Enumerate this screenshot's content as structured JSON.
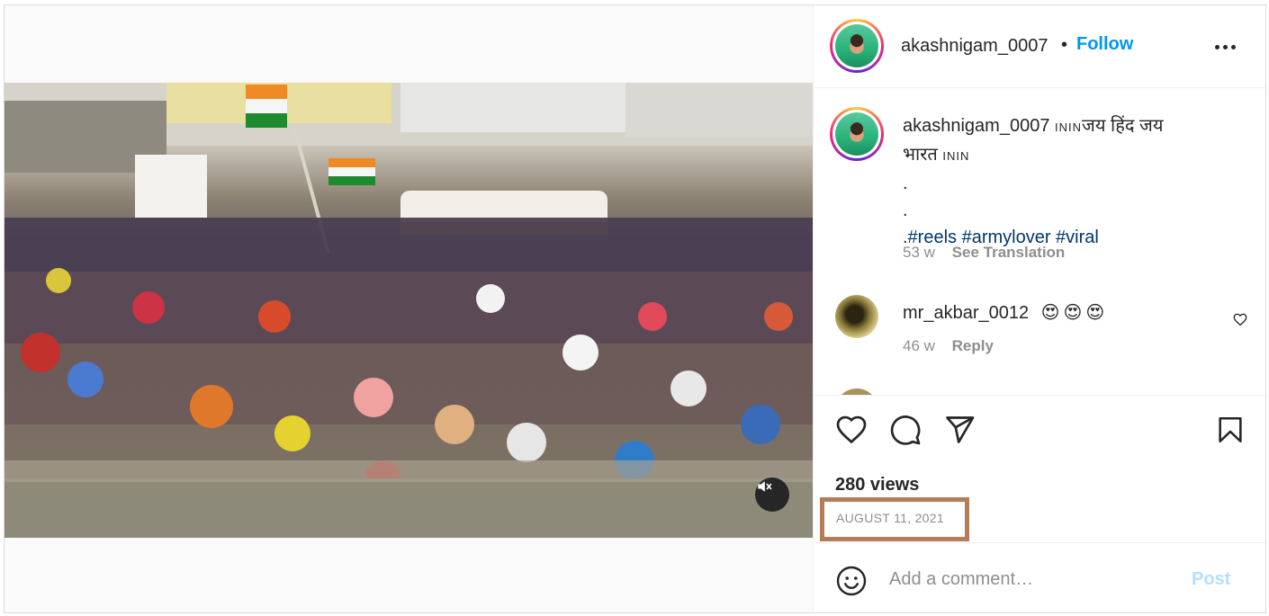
{
  "post": {
    "username": "akashnigam_0007",
    "separator": "•",
    "follow_label": "Follow",
    "more_icon": "more-options-icon"
  },
  "caption": {
    "username": "akashnigam_0007",
    "flag_text_1": "ININ",
    "text_1": "जय हिंद जय भारत",
    "flag_text_2": "ININ",
    "dot_1": ".",
    "dot_2": ".",
    "hashtags": ".#reels #armylover #viral",
    "age": "53 w",
    "see_translation": "See Translation"
  },
  "comments": [
    {
      "username": "mr_akbar_0012",
      "emojis": "😍😍😍",
      "age": "46 w",
      "reply_label": "Reply"
    }
  ],
  "stats": {
    "views": "280 views",
    "date": "AUGUST 11, 2021"
  },
  "add_comment": {
    "placeholder": "Add a comment…",
    "post_label": "Post"
  },
  "colors": {
    "follow": "#0095f6",
    "hashtag": "#00376b",
    "muted": "#8e8e8e",
    "post_disabled": "#b2dffc",
    "highlight_box": "#b57d57"
  }
}
